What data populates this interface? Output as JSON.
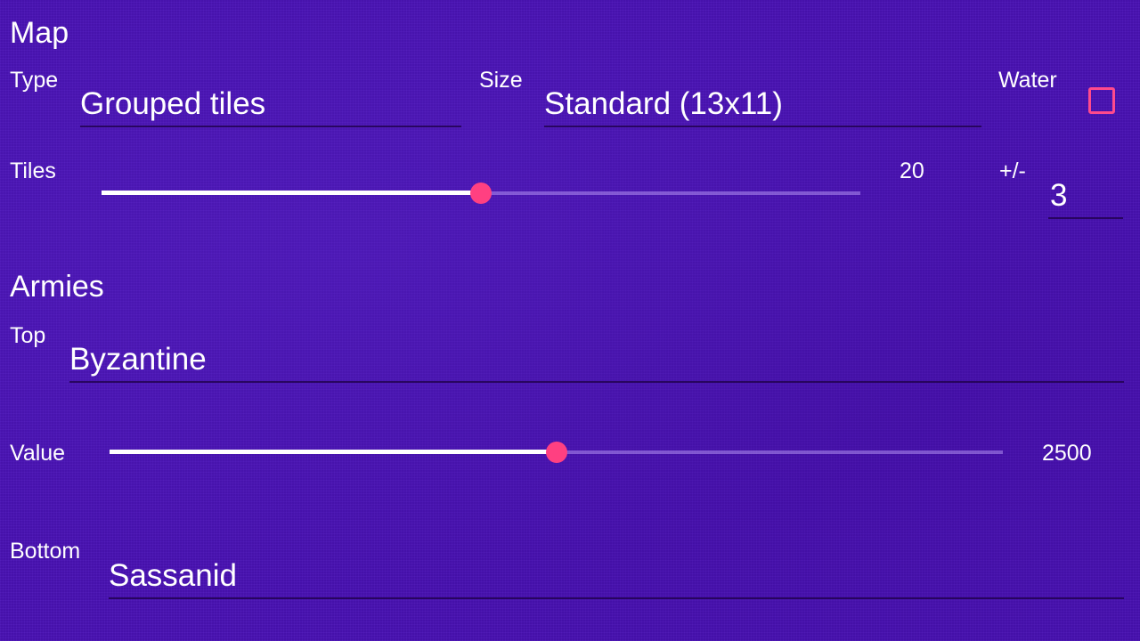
{
  "map": {
    "title": "Map",
    "type_label": "Type",
    "type_value": "Grouped tiles",
    "size_label": "Size",
    "size_value": "Standard (13x11)",
    "water_label": "Water",
    "water_checked": false,
    "tiles_label": "Tiles",
    "tiles_value": "20",
    "tiles_fraction": 0.5,
    "variance_label": "+/-",
    "variance_value": "3"
  },
  "armies": {
    "title": "Armies",
    "top_label": "Top",
    "top_value": "Byzantine",
    "value_label": "Value",
    "value_value": "2500",
    "value_fraction": 0.5,
    "bottom_label": "Bottom",
    "bottom_value": "Sassanid"
  },
  "colors": {
    "background": "#4a12b6",
    "accent": "#ff4081",
    "text": "#ffffff"
  }
}
